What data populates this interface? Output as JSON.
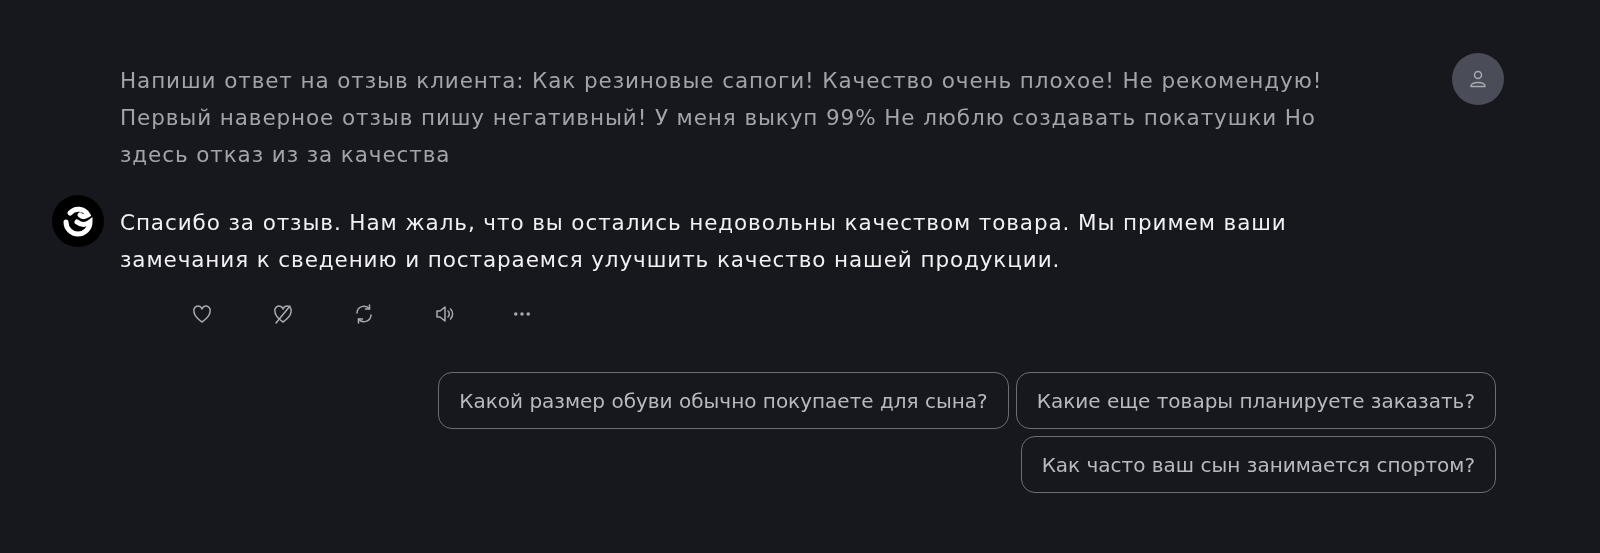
{
  "user_message": {
    "text": "Напиши ответ на отзыв клиента: Как резиновые сапоги! Качество очень плохое! Не рекомендую! Первый наверное отзыв пишу негативный! У меня выкуп 99% Не люблю создавать покатушки Но здесь отказ из за качества"
  },
  "bot_message": {
    "text": "Спасибо за отзыв. Нам жаль, что вы остались недовольны качеством товара. Мы примем ваши замечания к сведению и постараемся улучшить качество нашей продукции."
  },
  "actions": [
    {
      "kind": "like"
    },
    {
      "kind": "dislike"
    },
    {
      "kind": "regenerate"
    },
    {
      "kind": "speak"
    },
    {
      "kind": "more"
    }
  ],
  "suggestions": [
    "Какой размер обуви обычно покупаете для сына?",
    "Какие еще товары планируете заказать?",
    "Как часто ваш сын занимается спортом?"
  ]
}
